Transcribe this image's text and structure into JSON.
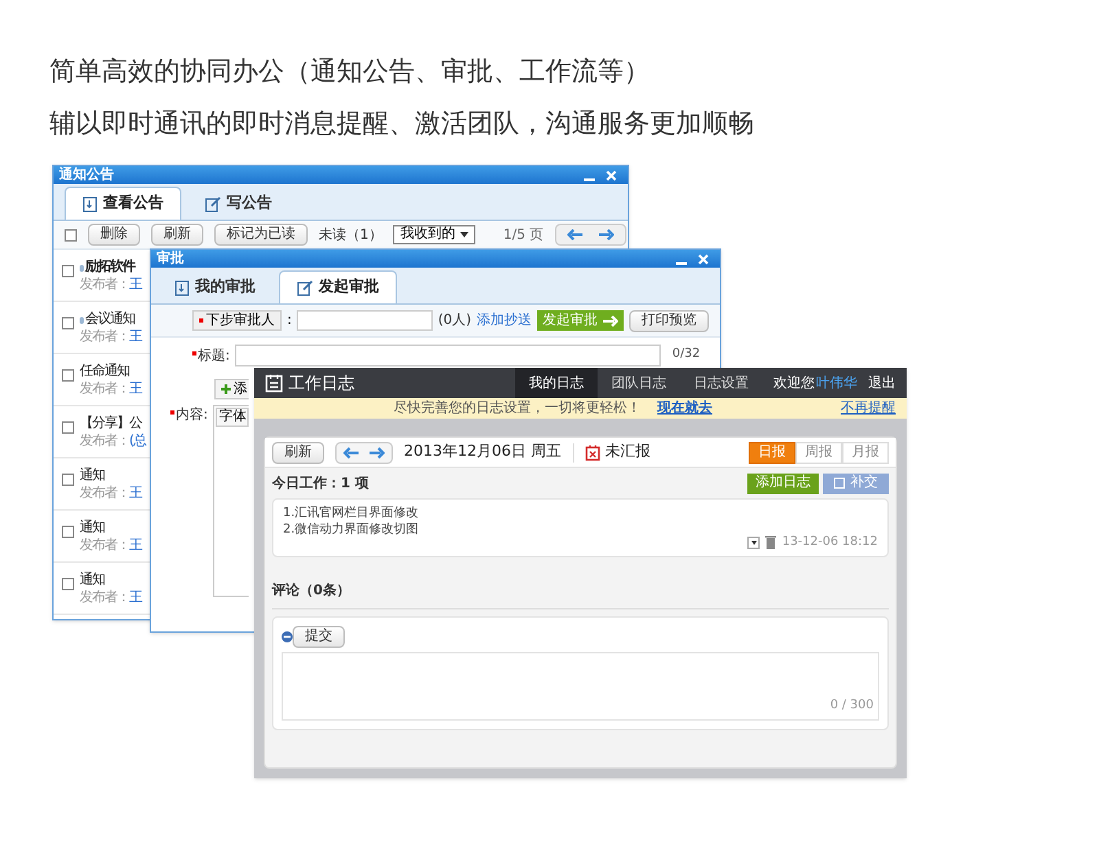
{
  "headline": [
    "简单高效的协同办公（通知公告、审批、工作流等）",
    "辅以即时通讯的即时消息提醒、激活团队，沟通服务更加顺畅"
  ],
  "notice_window": {
    "title": "通知公告",
    "tabs": [
      {
        "label": "查看公告",
        "selected": true
      },
      {
        "label": "写公告",
        "selected": false
      }
    ],
    "toolbar": {
      "select_all_checked": false,
      "buttons": [
        "删除",
        "刷新",
        "标记为已读"
      ],
      "unread": "未读（1）",
      "filter": "我收到的",
      "page": "1/5 页"
    },
    "items": [
      {
        "title": "励拓软件",
        "publisher_label": "发布者：",
        "publisher": "王",
        "unread": true,
        "marked": true,
        "checked": false
      },
      {
        "title": "会议通知",
        "publisher_label": "发布者：",
        "publisher": "王",
        "unread": false,
        "marked": true,
        "checked": false
      },
      {
        "title": "任命通知",
        "publisher_label": "发布者：",
        "publisher": "王",
        "unread": false,
        "marked": false,
        "checked": false
      },
      {
        "title": "【分享】公",
        "publisher_label": "发布者：",
        "publisher": "(总",
        "unread": false,
        "marked": false,
        "checked": false
      },
      {
        "title": "通知",
        "publisher_label": "发布者：",
        "publisher": "王",
        "unread": false,
        "marked": false,
        "checked": false
      },
      {
        "title": "通知",
        "publisher_label": "发布者：",
        "publisher": "王",
        "unread": false,
        "marked": false,
        "checked": false
      },
      {
        "title": "通知",
        "publisher_label": "发布者：",
        "publisher": "王",
        "unread": false,
        "marked": false,
        "checked": false
      }
    ]
  },
  "approval_window": {
    "title": "审批",
    "tabs": [
      {
        "label": "我的审批",
        "selected": false
      },
      {
        "label": "发起审批",
        "selected": true
      }
    ],
    "approver_label": "下步审批人",
    "approver_colon": ":",
    "count": "(0人)",
    "cc_link": "添加抄送",
    "submit": "发起审批",
    "preview": "打印预览",
    "title_label": "标题:",
    "counter": "0/32",
    "add_button": "添",
    "content_label": "内容:",
    "editor_font": "字体"
  },
  "worklog": {
    "title": "工作日志",
    "nav": [
      {
        "label": "我的日志",
        "selected": true
      },
      {
        "label": "团队日志",
        "selected": false
      },
      {
        "label": "日志设置",
        "selected": false
      }
    ],
    "welcome": "欢迎您",
    "user": "叶伟华",
    "logout": "退出",
    "banner": {
      "text": "尽快完善您的日志设置，一切将更轻松！",
      "link": "现在就去",
      "dismiss": "不再提醒"
    },
    "refresh": "刷新",
    "date": "2013年12月06日 周五",
    "status": "未汇报",
    "periods": [
      {
        "label": "日报",
        "selected": true
      },
      {
        "label": "周报",
        "selected": false
      },
      {
        "label": "月报",
        "selected": false
      }
    ],
    "today": "今日工作：1 项",
    "add": "添加日志",
    "supplement": "补交",
    "entry_lines": [
      "1.汇讯官网栏目界面修改",
      "2.微信动力界面修改切图"
    ],
    "timestamp": "13-12-06 18:12",
    "comments": "评论（0条）",
    "comment_submit": "提交",
    "comment_counter": "0 / 300"
  }
}
